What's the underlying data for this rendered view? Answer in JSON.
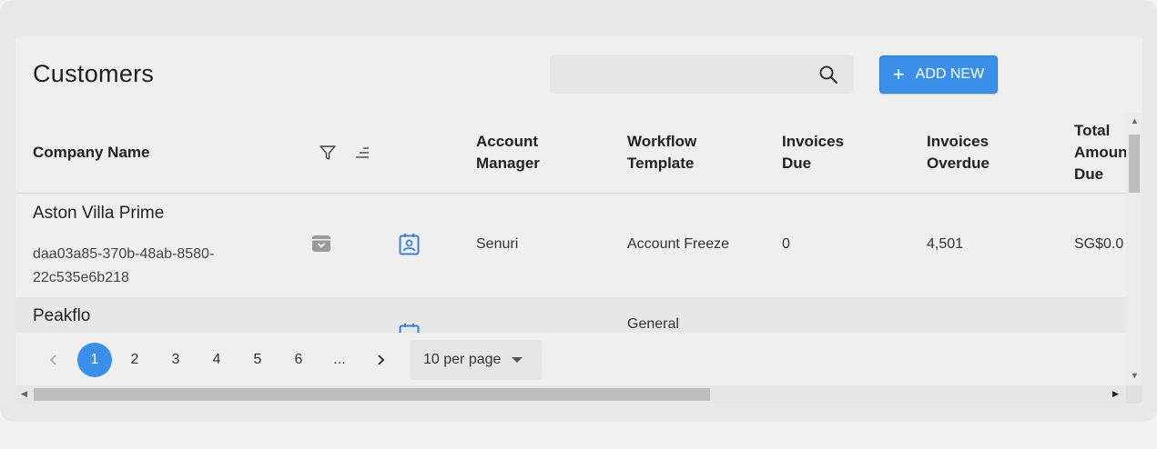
{
  "header": {
    "title": "Customers",
    "search_placeholder": "",
    "add_button_label": "ADD NEW"
  },
  "table": {
    "columns": [
      "Company Name",
      "Account Manager",
      "Workflow Template",
      "Invoices Due",
      "Invoices Overdue",
      "Total Amount Due"
    ],
    "column_lines": [
      [
        "Company Name"
      ],
      [
        "Account",
        "Manager"
      ],
      [
        "Workflow",
        "Template"
      ],
      [
        "Invoices",
        "Due"
      ],
      [
        "Invoices",
        "Overdue"
      ],
      [
        "Total",
        "Amoun",
        "Due"
      ]
    ],
    "rows": [
      {
        "company_name": "Aston Villa Prime",
        "company_id": "daa03a85-370b-48ab-8580-22c535e6b218",
        "account_manager": "Senuri",
        "workflow_template": "Account Freeze",
        "invoices_due": "0",
        "invoices_overdue": "4,501",
        "total_amount_due": "SG$0.0"
      },
      {
        "company_name": "Peakflo",
        "workflow_template": "General"
      }
    ]
  },
  "pagination": {
    "pages": [
      "1",
      "2",
      "3",
      "4",
      "5",
      "6",
      "..."
    ],
    "current_page": "1",
    "per_page_label": "10 per page"
  },
  "colors": {
    "accent": "#3b8fe8",
    "icon_blue": "#3b82d6",
    "icon_gray": "#9a9a9a"
  },
  "icons": {
    "search": "search-icon",
    "filter": "filter-icon",
    "sort": "sort-icon",
    "archive": "archive-icon",
    "contact": "contact-card-icon",
    "prev": "chevron-left-icon",
    "next": "chevron-right-icon"
  }
}
